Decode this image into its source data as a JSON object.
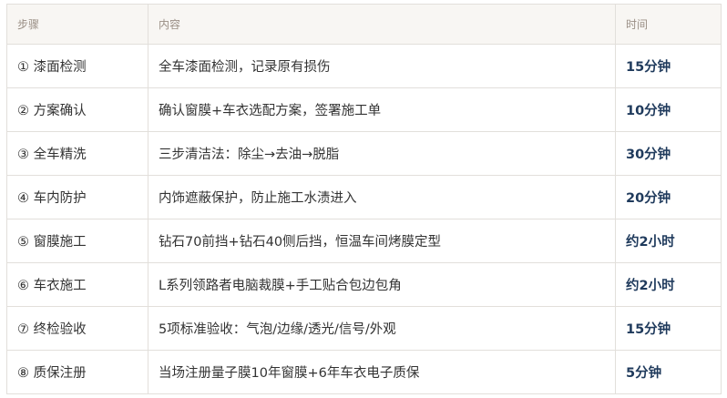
{
  "table": {
    "headers": [
      "步骤",
      "内容",
      "时间"
    ],
    "rows": [
      {
        "step": "① 漆面检测",
        "content": "全车漆面检测，记录原有损伤",
        "time": "15分钟"
      },
      {
        "step": "② 方案确认",
        "content": "确认窗膜+车衣选配方案，签署施工单",
        "time": "10分钟"
      },
      {
        "step": "③ 全车精洗",
        "content": "三步清洁法：除尘→去油→脱脂",
        "time": "30分钟"
      },
      {
        "step": "④ 车内防护",
        "content": "内饰遮蔽保护，防止施工水渍进入",
        "time": "20分钟"
      },
      {
        "step": "⑤ 窗膜施工",
        "content": "钻石70前挡+钻石40侧后挡，恒温车间烤膜定型",
        "time": "约2小时"
      },
      {
        "step": "⑥ 车衣施工",
        "content": "L系列领路者电脑裁膜+手工贴合包边包角",
        "time": "约2小时"
      },
      {
        "step": "⑦ 终检验收",
        "content": "5项标准验收：气泡/边缘/透光/信号/外观",
        "time": "15分钟"
      },
      {
        "step": "⑧ 质保注册",
        "content": "当场注册量子膜10年窗膜+6年车衣电子质保",
        "time": "5分钟"
      }
    ]
  },
  "colors": {
    "header_bg": "#f8f6f3",
    "header_text": "#9a8f85",
    "border": "#e2dfdb",
    "time_text": "#1f3a5c",
    "body_text": "#333333"
  }
}
